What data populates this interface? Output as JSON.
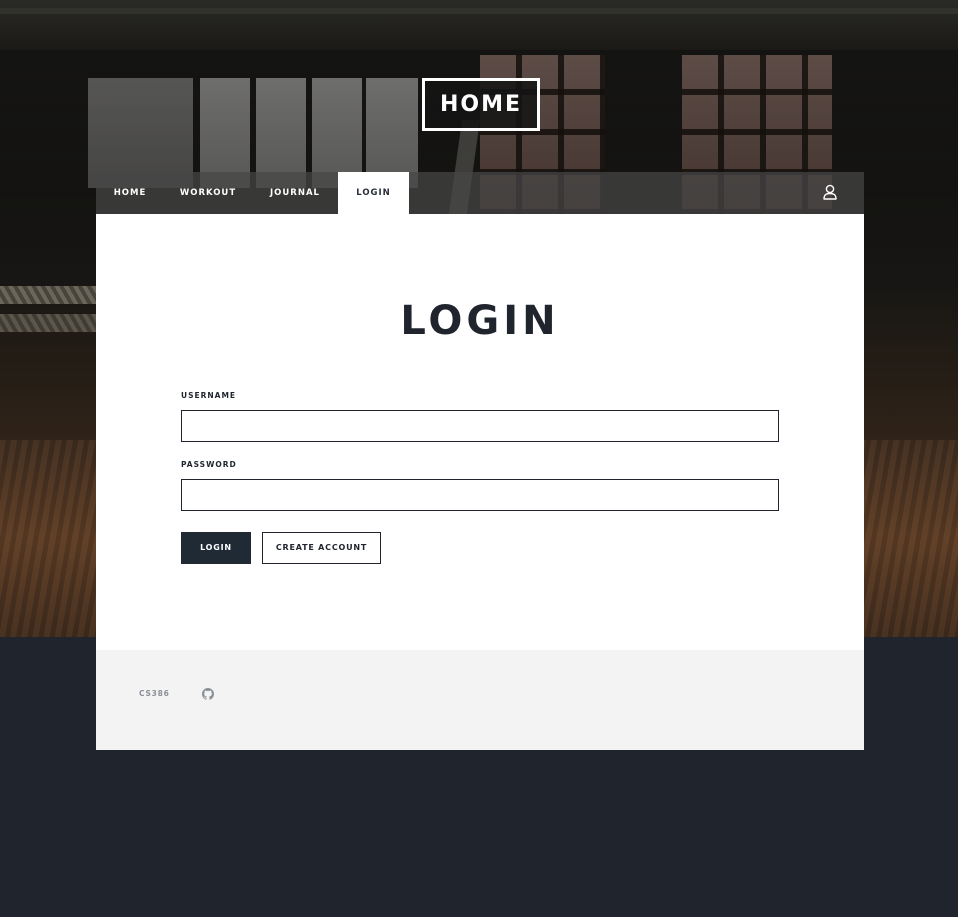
{
  "site": {
    "logo_text": "HOME"
  },
  "nav": {
    "items": [
      {
        "label": "HOME"
      },
      {
        "label": "WORKOUT"
      },
      {
        "label": "JOURNAL"
      },
      {
        "label": "LOGIN",
        "active": true
      }
    ],
    "user_icon": "user-icon"
  },
  "login_form": {
    "title": "LOGIN",
    "username_label": "USERNAME",
    "username_value": "",
    "password_label": "PASSWORD",
    "password_value": "",
    "login_button": "LOGIN",
    "create_account_button": "CREATE ACCOUNT"
  },
  "footer": {
    "text": "CS386",
    "github_icon": "github-icon"
  },
  "colors": {
    "page_bg": "#1f242d",
    "primary_button": "#1f2a35",
    "footer_bg": "#f3f3f3",
    "nav_bg": "#464646"
  }
}
